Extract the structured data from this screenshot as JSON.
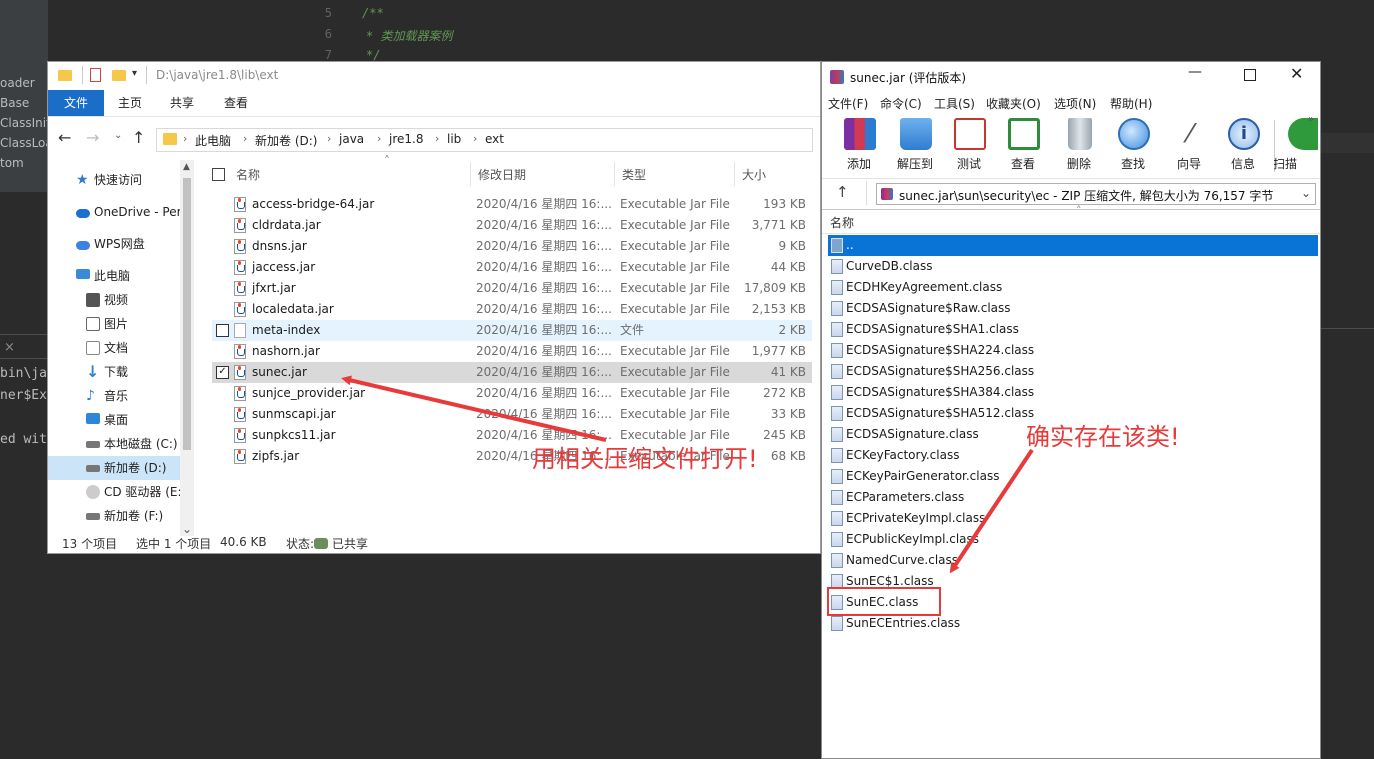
{
  "ide": {
    "left_items": [
      "oader",
      "Base",
      "ClassInit",
      "ClassLoa",
      "tom"
    ],
    "line_numbers": [
      "5",
      "6",
      "7"
    ],
    "code_lines": [
      "/**",
      "* 类加载器案例",
      "*/"
    ],
    "console_lines": [
      "bin\\ja",
      "ner$Ext",
      "ed with"
    ],
    "close_glyph": "×"
  },
  "explorer": {
    "qat_path": "D:\\java\\jre1.8\\lib\\ext",
    "ribbon_tabs": [
      "文件",
      "主页",
      "共享",
      "查看"
    ],
    "breadcrumb": [
      "此电脑",
      "新加卷 (D:)",
      "java",
      "jre1.8",
      "lib",
      "ext"
    ],
    "nav_items": [
      {
        "label": "快速访问",
        "icon": "star-icon",
        "color": "#3a78c9"
      },
      {
        "label": "OneDrive - Per",
        "icon": "cloud-icon",
        "color": "#1a6fd0"
      },
      {
        "label": "WPS网盘",
        "icon": "cloud-icon",
        "color": "#3c82e0"
      },
      {
        "label": "此电脑",
        "icon": "computer-icon",
        "color": "#3b8ad9"
      },
      {
        "label": "视频",
        "icon": "video-icon",
        "color": "#555555"
      },
      {
        "label": "图片",
        "icon": "picture-icon",
        "color": "#666666"
      },
      {
        "label": "文档",
        "icon": "document-icon",
        "color": "#888888"
      },
      {
        "label": "下载",
        "icon": "download-icon",
        "color": "#2f7fd8"
      },
      {
        "label": "音乐",
        "icon": "music-icon",
        "color": "#2f7fd8"
      },
      {
        "label": "桌面",
        "icon": "desktop-icon",
        "color": "#2f86d8"
      },
      {
        "label": "本地磁盘 (C:)",
        "icon": "drive-icon",
        "color": "#777777"
      },
      {
        "label": "新加卷 (D:)",
        "icon": "drive-icon",
        "color": "#777777"
      },
      {
        "label": "CD 驱动器 (E:)",
        "icon": "cd-icon",
        "color": "#999999"
      },
      {
        "label": "新加卷 (F:)",
        "icon": "drive-icon",
        "color": "#777777"
      }
    ],
    "columns": {
      "name": "名称",
      "date": "修改日期",
      "type": "类型",
      "size": "大小"
    },
    "files": [
      {
        "name": "access-bridge-64.jar",
        "date": "2020/4/16 星期四 16:...",
        "type": "Executable Jar File",
        "size": "193 KB"
      },
      {
        "name": "cldrdata.jar",
        "date": "2020/4/16 星期四 16:...",
        "type": "Executable Jar File",
        "size": "3,771 KB"
      },
      {
        "name": "dnsns.jar",
        "date": "2020/4/16 星期四 16:...",
        "type": "Executable Jar File",
        "size": "9 KB"
      },
      {
        "name": "jaccess.jar",
        "date": "2020/4/16 星期四 16:...",
        "type": "Executable Jar File",
        "size": "44 KB"
      },
      {
        "name": "jfxrt.jar",
        "date": "2020/4/16 星期四 16:...",
        "type": "Executable Jar File",
        "size": "17,809 KB"
      },
      {
        "name": "localedata.jar",
        "date": "2020/4/16 星期四 16:...",
        "type": "Executable Jar File",
        "size": "2,153 KB"
      },
      {
        "name": "meta-index",
        "date": "2020/4/16 星期四 16:...",
        "type": "文件",
        "size": "2 KB"
      },
      {
        "name": "nashorn.jar",
        "date": "2020/4/16 星期四 16:...",
        "type": "Executable Jar File",
        "size": "1,977 KB"
      },
      {
        "name": "sunec.jar",
        "date": "2020/4/16 星期四 16:...",
        "type": "Executable Jar File",
        "size": "41 KB"
      },
      {
        "name": "sunjce_provider.jar",
        "date": "2020/4/16 星期四 16:...",
        "type": "Executable Jar File",
        "size": "272 KB"
      },
      {
        "name": "sunmscapi.jar",
        "date": "2020/4/16 星期四 16:...",
        "type": "Executable Jar File",
        "size": "33 KB"
      },
      {
        "name": "sunpkcs11.jar",
        "date": "2020/4/16 星期四 16:...",
        "type": "Executable Jar File",
        "size": "245 KB"
      },
      {
        "name": "zipfs.jar",
        "date": "2020/4/16 星期四 16:...",
        "type": "Executable Jar File",
        "size": "68 KB"
      }
    ],
    "status": {
      "count": "13 个项目",
      "selected": "选中 1 个项目",
      "size": "40.6 KB",
      "state_label": "状态:",
      "state_value": "已共享"
    }
  },
  "winrar": {
    "title": "sunec.jar (评估版本)",
    "menus": [
      "文件(F)",
      "命令(C)",
      "工具(S)",
      "收藏夹(O)",
      "选项(N)",
      "帮助(H)"
    ],
    "toolbar": [
      {
        "label": "添加",
        "icon": "add-archive-icon"
      },
      {
        "label": "解压到",
        "icon": "extract-folder-icon"
      },
      {
        "label": "测试",
        "icon": "test-clipboard-icon"
      },
      {
        "label": "查看",
        "icon": "view-book-icon"
      },
      {
        "label": "删除",
        "icon": "trash-icon"
      },
      {
        "label": "查找",
        "icon": "magnifier-icon"
      },
      {
        "label": "向导",
        "icon": "wizard-wand-icon"
      },
      {
        "label": "信息",
        "icon": "info-icon"
      },
      {
        "label": "扫描",
        "icon": "scan-icon"
      }
    ],
    "path": "sunec.jar\\sun\\security\\ec - ZIP 压缩文件, 解包大小为 76,157 字节",
    "column_name": "名称",
    "parent_entry": "..",
    "entries": [
      "CurveDB.class",
      "ECDHKeyAgreement.class",
      "ECDSASignature$Raw.class",
      "ECDSASignature$SHA1.class",
      "ECDSASignature$SHA224.class",
      "ECDSASignature$SHA256.class",
      "ECDSASignature$SHA384.class",
      "ECDSASignature$SHA512.class",
      "ECDSASignature.class",
      "ECKeyFactory.class",
      "ECKeyPairGenerator.class",
      "ECParameters.class",
      "ECPrivateKeyImpl.class",
      "ECPublicKeyImpl.class",
      "NamedCurve.class",
      "SunEC$1.class",
      "SunEC.class",
      "SunECEntries.class"
    ]
  },
  "annotations": {
    "open_with_archiver": "用相关压缩文件打开!",
    "class_exists": "确实存在该类!",
    "color": "#e83a3a"
  }
}
